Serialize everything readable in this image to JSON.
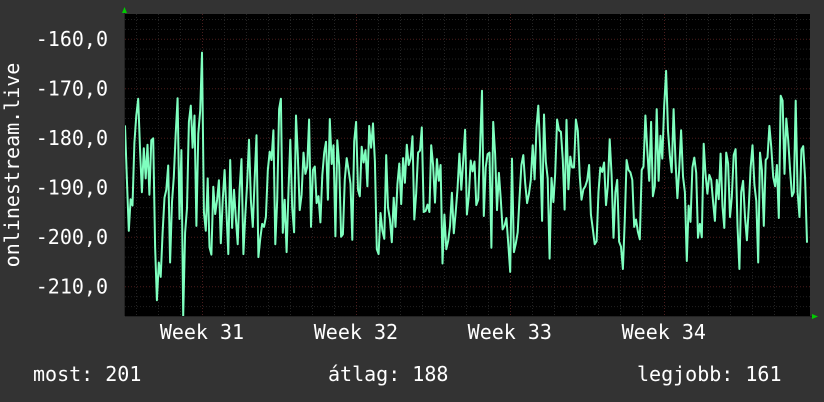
{
  "chart_data": {
    "type": "line",
    "ylabel": "onlinestream.live",
    "ylim": [
      -216,
      -155
    ],
    "yticks": [
      -160,
      -170,
      -180,
      -190,
      -200,
      -210
    ],
    "ytick_labels": [
      "-160,0",
      "-170,0",
      "-180,0",
      "-190,0",
      "-200,0",
      "-210,0"
    ],
    "xlim": [
      30.5,
      34.95
    ],
    "xticks": [
      31,
      32,
      33,
      34
    ],
    "xtick_labels": [
      "Week 31",
      "Week 32",
      "Week 33",
      "Week 34"
    ],
    "grid": true,
    "series": [
      {
        "values": [
          -177.5,
          -188.5,
          -198.8,
          -192.4,
          -193.7,
          -181.0,
          -175.5,
          -172.1,
          -182.2,
          -191.0,
          -182.1,
          -188.2,
          -181.4,
          -191.5,
          -180.5,
          -180.1,
          -202.0,
          -212.8,
          -205.2,
          -208.1,
          -199.2,
          -192.1,
          -190.5,
          -185.6,
          -205.2,
          -193.0,
          -187.9,
          -179.2,
          -172.0,
          -196.4,
          -182.5,
          -216.0,
          -199.2,
          -194.2,
          -176.8,
          -173.5,
          -182.0,
          -175.5,
          -197.8,
          -179.2,
          -174.5,
          -162.8,
          -195.0,
          -198.8,
          -188.2,
          -202.1,
          -203.6,
          -189.9,
          -195.4,
          -192.5,
          -188.6,
          -201.3,
          -192.7,
          -186.5,
          -195.2,
          -203.5,
          -184.5,
          -198.2,
          -190.5,
          -196.1,
          -201.5,
          -190.4,
          -184.3,
          -203.5,
          -196.0,
          -189.4,
          -180.4,
          -192.7,
          -198.0,
          -188.6,
          -179.5,
          -204.1,
          -200.3,
          -197.4,
          -198.0,
          -196.0,
          -186.6,
          -182.8,
          -184.5,
          -178.5,
          -201.5,
          -192.6,
          -174.2,
          -172.1,
          -199.2,
          -192.5,
          -203.1,
          -190.7,
          -180.4,
          -194.1,
          -199.1,
          -175.5,
          -183.5,
          -194.6,
          -191.5,
          -183.0,
          -187.3,
          -185.8,
          -176.3,
          -198.0,
          -186.5,
          -185.8,
          -193.2,
          -191.8,
          -197.1,
          -187.6,
          -183.0,
          -180.8,
          -192.5,
          -176.2,
          -185.3,
          -181.5,
          -199.9,
          -180.5,
          -185.5,
          -200.0,
          -199.5,
          -188.4,
          -184.1,
          -186.6,
          -189.3,
          -200.6,
          -180.7,
          -176.8,
          -190.5,
          -191.8,
          -181.8,
          -185.0,
          -182.5,
          -189.8,
          -177.6,
          -182.0,
          -177.1,
          -184.8,
          -202.5,
          -203.5,
          -195.2,
          -198.8,
          -200.4,
          -183.5,
          -194.1,
          -196.4,
          -201.1,
          -192.1,
          -198.0,
          -189.4,
          -185.2,
          -193.4,
          -184.1,
          -189.1,
          -181.4,
          -185.5,
          -184.2,
          -179.7,
          -196.5,
          -191.2,
          -183.0,
          -182.6,
          -177.9,
          -195.0,
          -194.8,
          -193.5,
          -195.0,
          -181.5,
          -185.5,
          -193.1,
          -184.3,
          -188.7,
          -185.5,
          -205.4,
          -195.5,
          -202.5,
          -200.8,
          -197.9,
          -191.1,
          -199.3,
          -195.0,
          -190.4,
          -183.2,
          -190.5,
          -184.6,
          -178.4,
          -195.5,
          -191.8,
          -184.6,
          -186.8,
          -184.8,
          -193.6,
          -192.5,
          -181.8,
          -170.5,
          -195.8,
          -186.0,
          -183.3,
          -183.0,
          -202.2,
          -176.8,
          -183.2,
          -194.6,
          -187.1,
          -192.5,
          -198.5,
          -197.8,
          -196.2,
          -201.5,
          -207.1,
          -184.2,
          -203.1,
          -201.4,
          -199.1,
          -192.2,
          -185.5,
          -183.5,
          -189.2,
          -193.2,
          -191.4,
          -188.5,
          -181.5,
          -188.4,
          -177.9,
          -173.5,
          -182.5,
          -196.8,
          -175.3,
          -184.8,
          -188.2,
          -204.4,
          -188.1,
          -193.0,
          -187.2,
          -176.3,
          -178.5,
          -178.8,
          -184.5,
          -194.5,
          -176.4,
          -190.4,
          -183.8,
          -186.0,
          -186.0,
          -176.3,
          -178.6,
          -187.6,
          -192.5,
          -190.4,
          -189.8,
          -188.6,
          -185.5,
          -195.5,
          -198.4,
          -201.5,
          -200.9,
          -191.0,
          -186.0,
          -186.9,
          -185.0,
          -193.6,
          -189.8,
          -180.3,
          -187.5,
          -200.2,
          -191.0,
          -188.5,
          -201.0,
          -202.0,
          -206.5,
          -196.5,
          -184.5,
          -186.5,
          -187.0,
          -188.5,
          -198.0,
          -196.5,
          -199.0,
          -200.5,
          -186.5,
          -185.8,
          -175.5,
          -182.5,
          -188.7,
          -176.8,
          -191.8,
          -189.8,
          -174.2,
          -188.7,
          -179.6,
          -184.2,
          -173.5,
          -166.5,
          -178.5,
          -183.5,
          -187.0,
          -174.2,
          -184.7,
          -192.2,
          -186.4,
          -178.5,
          -187.8,
          -191.0,
          -204.9,
          -193.7,
          -197.0,
          -186.0,
          -184.0,
          -187.1,
          -200.2,
          -197.4,
          -200.1,
          -181.2,
          -187.3,
          -191.3,
          -187.5,
          -188.5,
          -193.0,
          -196.8,
          -188.5,
          -192.4,
          -183.2,
          -193.9,
          -198.2,
          -183.0,
          -185.2,
          -196.0,
          -192.0,
          -183.5,
          -182.3,
          -197.8,
          -206.5,
          -191.0,
          -188.7,
          -196.0,
          -200.7,
          -193.9,
          -186.1,
          -181.5,
          -189.5,
          -192.8,
          -205.2,
          -183.0,
          -186.5,
          -197.8,
          -184.5,
          -184.0,
          -177.6,
          -182.0,
          -187.9,
          -189.8,
          -185.5,
          -196.2,
          -171.5,
          -172.5,
          -187.3,
          -176.1,
          -180.5,
          -186.6,
          -191.8,
          -191.0,
          -172.5,
          -191.0,
          -196.0,
          -182.4,
          -181.7,
          -188.2,
          -201.2
        ]
      }
    ]
  },
  "stats": {
    "now": "most: 201",
    "avg": "átlag: 188",
    "best": "legjobb: 161"
  },
  "colors": {
    "background": "#333333",
    "plot_background": "#000000",
    "line": "#7fffbf",
    "grid_major": "#4a1d1d",
    "grid_minor": "#232323",
    "text": "#ffffff",
    "axis_arrow": "#00cc00"
  }
}
